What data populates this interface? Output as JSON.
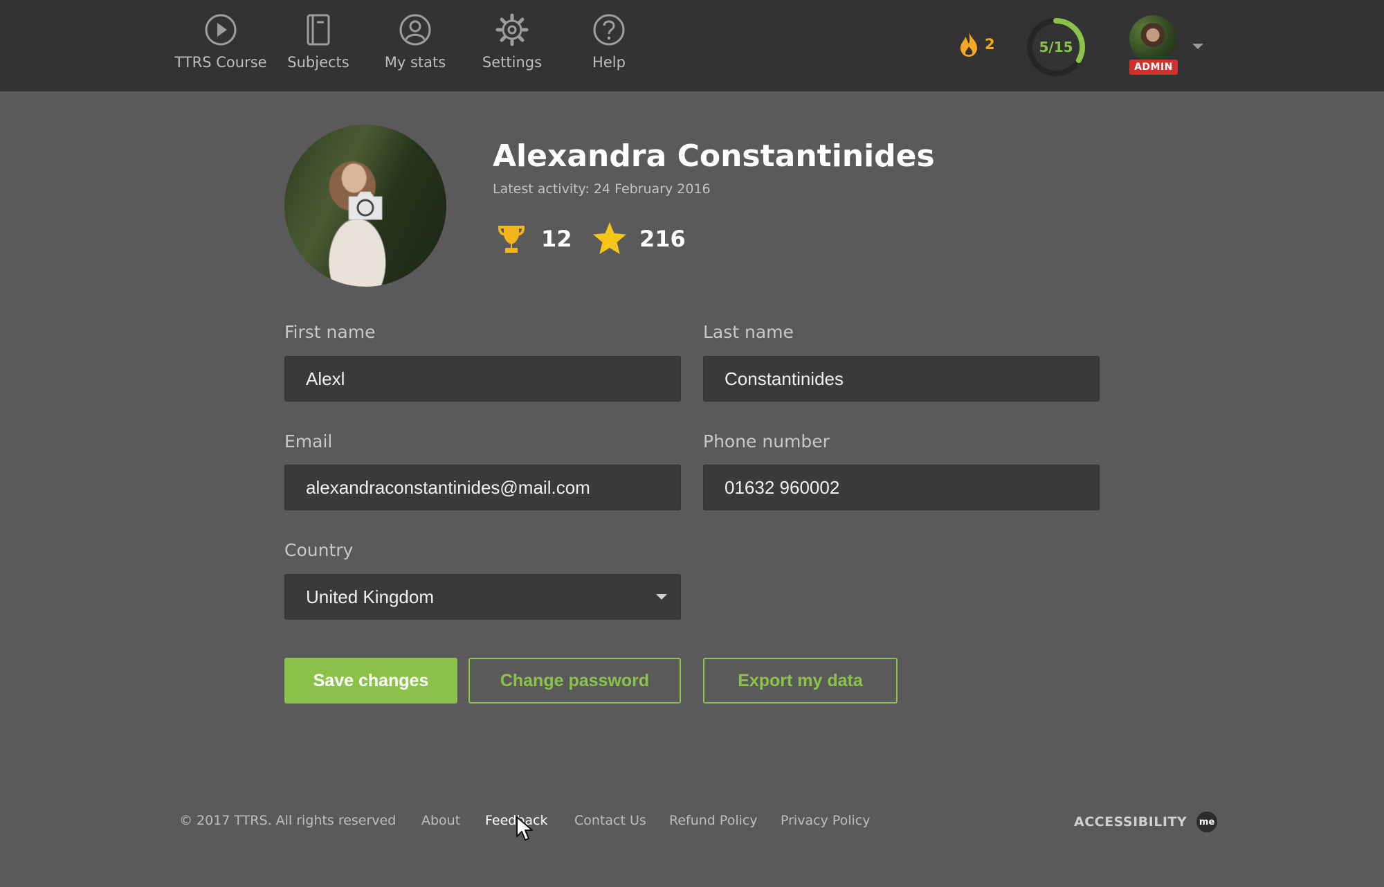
{
  "nav": {
    "items": [
      {
        "label": "TTRS Course",
        "icon": "play-circle-icon"
      },
      {
        "label": "Subjects",
        "icon": "book-icon"
      },
      {
        "label": "My stats",
        "icon": "user-circle-icon"
      },
      {
        "label": "Settings",
        "icon": "gear-icon"
      },
      {
        "label": "Help",
        "icon": "help-circle-icon"
      }
    ],
    "streak_count": "2",
    "progress_text": "5/15",
    "progress_fraction": 0.3333,
    "admin_badge": "ADMIN"
  },
  "profile": {
    "name": "Alexandra Constantinides",
    "latest_activity": "Latest activity: 24 February 2016",
    "trophies": "12",
    "stars": "216"
  },
  "form": {
    "first_name_label": "First name",
    "first_name_value": "Alexl",
    "last_name_label": "Last name",
    "last_name_value": "Constantinides",
    "email_label": "Email",
    "email_value": "alexandraconstantinides@mail.com",
    "phone_label": "Phone number",
    "phone_value": "01632 960002",
    "country_label": "Country",
    "country_value": "United Kingdom"
  },
  "buttons": {
    "save": "Save changes",
    "change_password": "Change password",
    "export": "Export my data"
  },
  "footer": {
    "copyright": "© 2017 TTRS. All rights reserved",
    "links": [
      "About",
      "Feedback",
      "Contact Us",
      "Refund Policy",
      "Privacy Policy"
    ],
    "accessibility": "ACCESSIBILITY",
    "me_badge": "me"
  },
  "colors": {
    "accent": "#8bc34a",
    "topbar": "#333333",
    "background": "#5a5a5a",
    "admin": "#d0312d",
    "streak": "#f5a623"
  }
}
